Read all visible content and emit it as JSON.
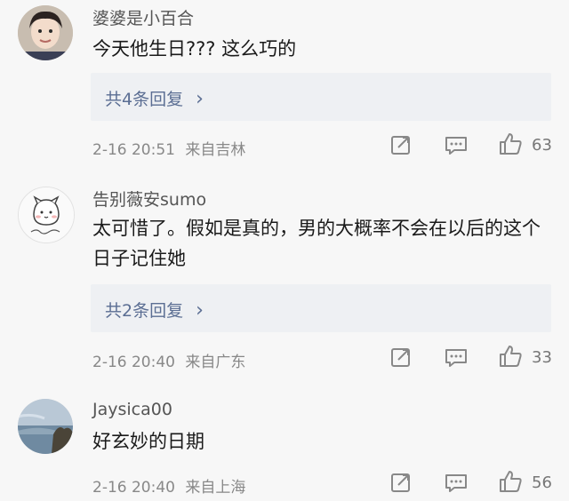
{
  "comments": [
    {
      "username": "婆婆是小百合",
      "text": "今天他生日??? 这么巧的",
      "replies": "共4条回复",
      "date": "2-16 20:51",
      "location": "来自吉林",
      "likes": "63",
      "icons": [
        "share-icon",
        "comment-icon",
        "like-icon"
      ]
    },
    {
      "username": "告别薇安sumo",
      "text": "太可惜了。假如是真的，男的大概率不会在以后的这个日子记住她",
      "replies": "共2条回复",
      "date": "2-16 20:40",
      "location": "来自广东",
      "likes": "33",
      "icons": [
        "share-icon",
        "comment-icon",
        "like-icon"
      ]
    },
    {
      "username": "Jaysica00",
      "text": "好玄妙的日期",
      "date": "2-16 20:40",
      "location": "来自上海",
      "likes": "56",
      "icons": [
        "share-icon",
        "comment-icon",
        "like-icon"
      ]
    }
  ],
  "reply_arrow": "›"
}
